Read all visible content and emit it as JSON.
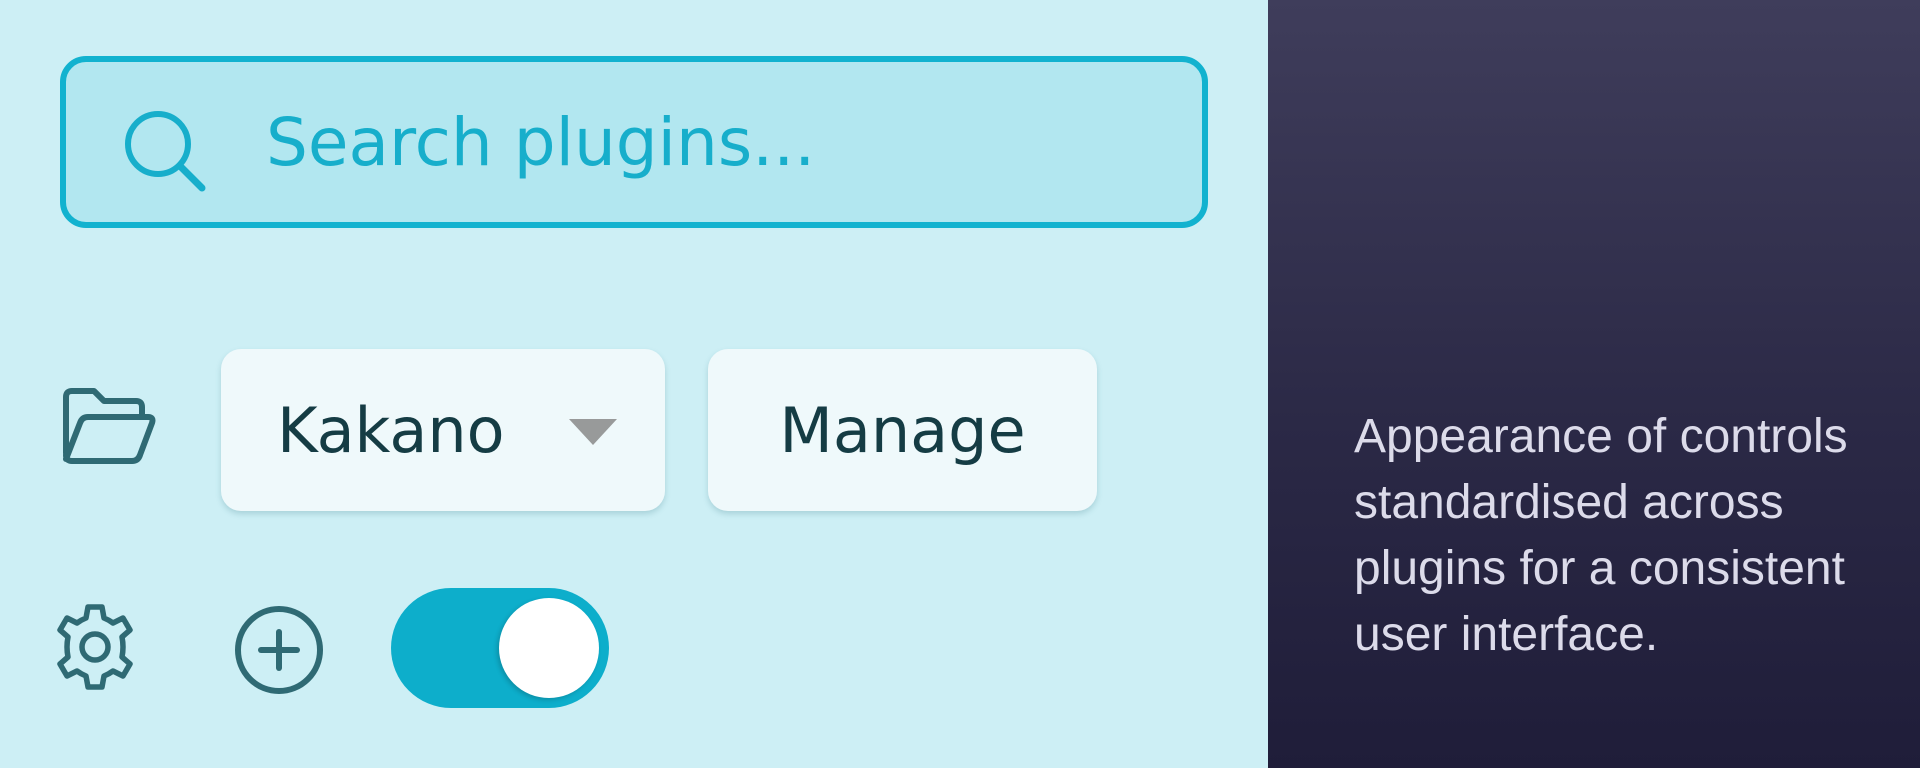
{
  "search": {
    "placeholder": "Search plugins...",
    "value": ""
  },
  "plugin_selector": {
    "selected": "Kakano"
  },
  "actions": {
    "manage_label": "Manage"
  },
  "toggle": {
    "state": "on"
  },
  "icons": {
    "search": "search-icon",
    "folder": "folder-open-icon",
    "caret": "caret-down-icon",
    "gear": "gear-icon",
    "plus": "plus-circle-icon"
  },
  "description": {
    "text": "Appearance of controls standardised across plugins for a consistent user interface."
  },
  "colors": {
    "accent": "#12b2cf",
    "panel_left_bg": "#cdeff5",
    "panel_right_bg": "#2b2946",
    "button_bg": "#eff9fb",
    "text_dark": "#153c44",
    "icon_color": "#2f6a74"
  }
}
